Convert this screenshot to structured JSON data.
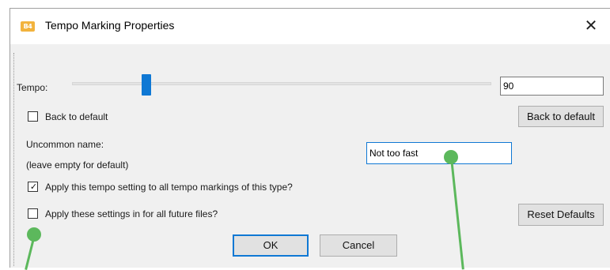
{
  "window": {
    "icon_text": "B4",
    "title": "Tempo Marking Properties",
    "close_glyph": "✕"
  },
  "tempo": {
    "label": "Tempo:",
    "value": "90",
    "slider_level": 0.17
  },
  "back_to_default": {
    "checkbox_label": "Back to default",
    "checked": false,
    "button_label": "Back to default"
  },
  "uncommon_name": {
    "label_line1": "Uncommon name:",
    "label_line2": "(leave empty for default)",
    "value": "Not too fast"
  },
  "apply_all": {
    "label": "Apply this tempo setting to all tempo markings of this type?",
    "checked": true
  },
  "apply_future": {
    "label": "Apply these settings in for all future files?",
    "checked": false
  },
  "buttons": {
    "reset_defaults": "Reset Defaults",
    "ok": "OK",
    "cancel": "Cancel"
  },
  "colors": {
    "accent": "#0f78d4",
    "annotation": "#5cb85c",
    "dialog_bg": "#f0f0f0"
  },
  "icons": {
    "app": "app-logo-icon",
    "close": "close-icon",
    "check": "checkmark-icon"
  }
}
